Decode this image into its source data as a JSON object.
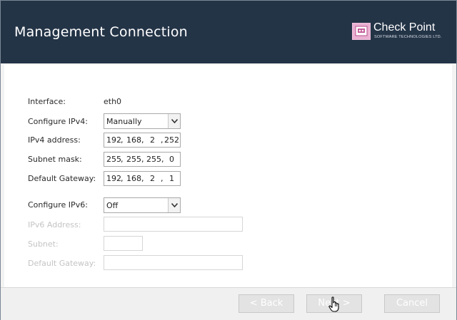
{
  "header": {
    "title": "Management Connection",
    "logo_name": "Check Point",
    "logo_subtitle": "SOFTWARE TECHNOLOGIES LTD."
  },
  "form": {
    "interface": {
      "label": "Interface:",
      "value": "eth0"
    },
    "configure_ipv4": {
      "label": "Configure IPv4:",
      "value": "Manually"
    },
    "ipv4_address": {
      "label": "IPv4 address:",
      "octets": [
        "192",
        "168",
        "2",
        "252"
      ]
    },
    "subnet_mask": {
      "label": "Subnet mask:",
      "octets": [
        "255",
        "255",
        "255",
        "0"
      ]
    },
    "default_gateway": {
      "label": "Default Gateway:",
      "octets": [
        "192",
        "168",
        "2",
        "1"
      ]
    },
    "configure_ipv6": {
      "label": "Configure IPv6:",
      "value": "Off"
    },
    "ipv6_address": {
      "label": "IPv6 Address:",
      "value": ""
    },
    "ipv6_subnet": {
      "label": "Subnet:",
      "value": ""
    },
    "ipv6_gateway": {
      "label": "Default Gateway:",
      "value": ""
    }
  },
  "footer": {
    "back_label": "< Back",
    "next_label": "Next >",
    "cancel_label": "Cancel"
  },
  "colors": {
    "header_bg": "#243447",
    "logo_accent": "#e9b0d1"
  }
}
